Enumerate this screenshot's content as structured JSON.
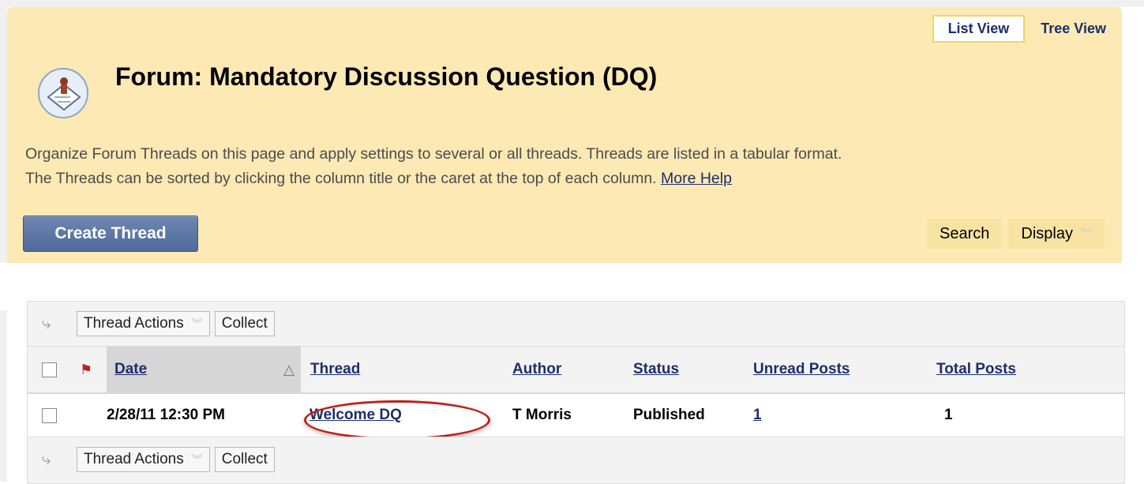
{
  "header": {
    "view_toggle": {
      "list_view": "List View",
      "tree_view": "Tree View"
    },
    "title": "Forum: Mandatory Discussion Question (DQ)",
    "description_line1": "Organize Forum Threads on this page and apply settings to several or all threads. Threads are listed in a tabular format.",
    "description_line2": "The Threads can be sorted by clicking the column title or the caret at the top of each column.",
    "more_help": "More Help",
    "create_button": "Create Thread",
    "search_button": "Search",
    "display_button": "Display"
  },
  "actions": {
    "thread_actions": "Thread Actions",
    "collect": "Collect"
  },
  "table": {
    "columns": [
      "Date",
      "Thread",
      "Author",
      "Status",
      "Unread Posts",
      "Total Posts"
    ],
    "rows": [
      {
        "date": "2/28/11 12:30 PM",
        "thread": "Welcome DQ",
        "author": "T Morris",
        "status": "Published",
        "unread": "1",
        "total": "1"
      }
    ]
  },
  "colors": {
    "header_bg": "#fce9b4",
    "link": "#1d2e6b",
    "create_btn": "#5a75a4",
    "highlight_ring": "#b82420"
  }
}
